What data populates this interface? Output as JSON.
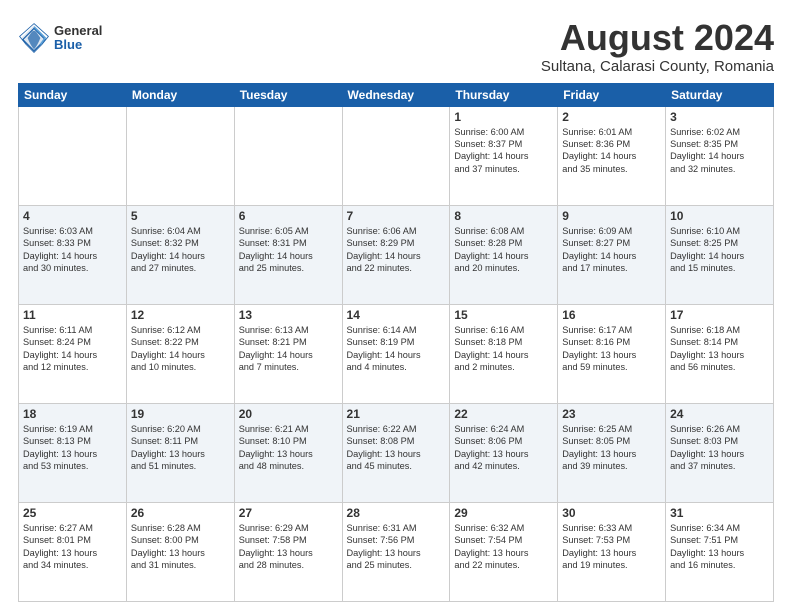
{
  "header": {
    "logo": {
      "general": "General",
      "blue": "Blue"
    },
    "title": "August 2024",
    "location": "Sultana, Calarasi County, Romania"
  },
  "calendar": {
    "days_of_week": [
      "Sunday",
      "Monday",
      "Tuesday",
      "Wednesday",
      "Thursday",
      "Friday",
      "Saturday"
    ],
    "weeks": [
      [
        {
          "day": "",
          "info": ""
        },
        {
          "day": "",
          "info": ""
        },
        {
          "day": "",
          "info": ""
        },
        {
          "day": "",
          "info": ""
        },
        {
          "day": "1",
          "info": "Sunrise: 6:00 AM\nSunset: 8:37 PM\nDaylight: 14 hours\nand 37 minutes."
        },
        {
          "day": "2",
          "info": "Sunrise: 6:01 AM\nSunset: 8:36 PM\nDaylight: 14 hours\nand 35 minutes."
        },
        {
          "day": "3",
          "info": "Sunrise: 6:02 AM\nSunset: 8:35 PM\nDaylight: 14 hours\nand 32 minutes."
        }
      ],
      [
        {
          "day": "4",
          "info": "Sunrise: 6:03 AM\nSunset: 8:33 PM\nDaylight: 14 hours\nand 30 minutes."
        },
        {
          "day": "5",
          "info": "Sunrise: 6:04 AM\nSunset: 8:32 PM\nDaylight: 14 hours\nand 27 minutes."
        },
        {
          "day": "6",
          "info": "Sunrise: 6:05 AM\nSunset: 8:31 PM\nDaylight: 14 hours\nand 25 minutes."
        },
        {
          "day": "7",
          "info": "Sunrise: 6:06 AM\nSunset: 8:29 PM\nDaylight: 14 hours\nand 22 minutes."
        },
        {
          "day": "8",
          "info": "Sunrise: 6:08 AM\nSunset: 8:28 PM\nDaylight: 14 hours\nand 20 minutes."
        },
        {
          "day": "9",
          "info": "Sunrise: 6:09 AM\nSunset: 8:27 PM\nDaylight: 14 hours\nand 17 minutes."
        },
        {
          "day": "10",
          "info": "Sunrise: 6:10 AM\nSunset: 8:25 PM\nDaylight: 14 hours\nand 15 minutes."
        }
      ],
      [
        {
          "day": "11",
          "info": "Sunrise: 6:11 AM\nSunset: 8:24 PM\nDaylight: 14 hours\nand 12 minutes."
        },
        {
          "day": "12",
          "info": "Sunrise: 6:12 AM\nSunset: 8:22 PM\nDaylight: 14 hours\nand 10 minutes."
        },
        {
          "day": "13",
          "info": "Sunrise: 6:13 AM\nSunset: 8:21 PM\nDaylight: 14 hours\nand 7 minutes."
        },
        {
          "day": "14",
          "info": "Sunrise: 6:14 AM\nSunset: 8:19 PM\nDaylight: 14 hours\nand 4 minutes."
        },
        {
          "day": "15",
          "info": "Sunrise: 6:16 AM\nSunset: 8:18 PM\nDaylight: 14 hours\nand 2 minutes."
        },
        {
          "day": "16",
          "info": "Sunrise: 6:17 AM\nSunset: 8:16 PM\nDaylight: 13 hours\nand 59 minutes."
        },
        {
          "day": "17",
          "info": "Sunrise: 6:18 AM\nSunset: 8:14 PM\nDaylight: 13 hours\nand 56 minutes."
        }
      ],
      [
        {
          "day": "18",
          "info": "Sunrise: 6:19 AM\nSunset: 8:13 PM\nDaylight: 13 hours\nand 53 minutes."
        },
        {
          "day": "19",
          "info": "Sunrise: 6:20 AM\nSunset: 8:11 PM\nDaylight: 13 hours\nand 51 minutes."
        },
        {
          "day": "20",
          "info": "Sunrise: 6:21 AM\nSunset: 8:10 PM\nDaylight: 13 hours\nand 48 minutes."
        },
        {
          "day": "21",
          "info": "Sunrise: 6:22 AM\nSunset: 8:08 PM\nDaylight: 13 hours\nand 45 minutes."
        },
        {
          "day": "22",
          "info": "Sunrise: 6:24 AM\nSunset: 8:06 PM\nDaylight: 13 hours\nand 42 minutes."
        },
        {
          "day": "23",
          "info": "Sunrise: 6:25 AM\nSunset: 8:05 PM\nDaylight: 13 hours\nand 39 minutes."
        },
        {
          "day": "24",
          "info": "Sunrise: 6:26 AM\nSunset: 8:03 PM\nDaylight: 13 hours\nand 37 minutes."
        }
      ],
      [
        {
          "day": "25",
          "info": "Sunrise: 6:27 AM\nSunset: 8:01 PM\nDaylight: 13 hours\nand 34 minutes."
        },
        {
          "day": "26",
          "info": "Sunrise: 6:28 AM\nSunset: 8:00 PM\nDaylight: 13 hours\nand 31 minutes."
        },
        {
          "day": "27",
          "info": "Sunrise: 6:29 AM\nSunset: 7:58 PM\nDaylight: 13 hours\nand 28 minutes."
        },
        {
          "day": "28",
          "info": "Sunrise: 6:31 AM\nSunset: 7:56 PM\nDaylight: 13 hours\nand 25 minutes."
        },
        {
          "day": "29",
          "info": "Sunrise: 6:32 AM\nSunset: 7:54 PM\nDaylight: 13 hours\nand 22 minutes."
        },
        {
          "day": "30",
          "info": "Sunrise: 6:33 AM\nSunset: 7:53 PM\nDaylight: 13 hours\nand 19 minutes."
        },
        {
          "day": "31",
          "info": "Sunrise: 6:34 AM\nSunset: 7:51 PM\nDaylight: 13 hours\nand 16 minutes."
        }
      ]
    ]
  }
}
